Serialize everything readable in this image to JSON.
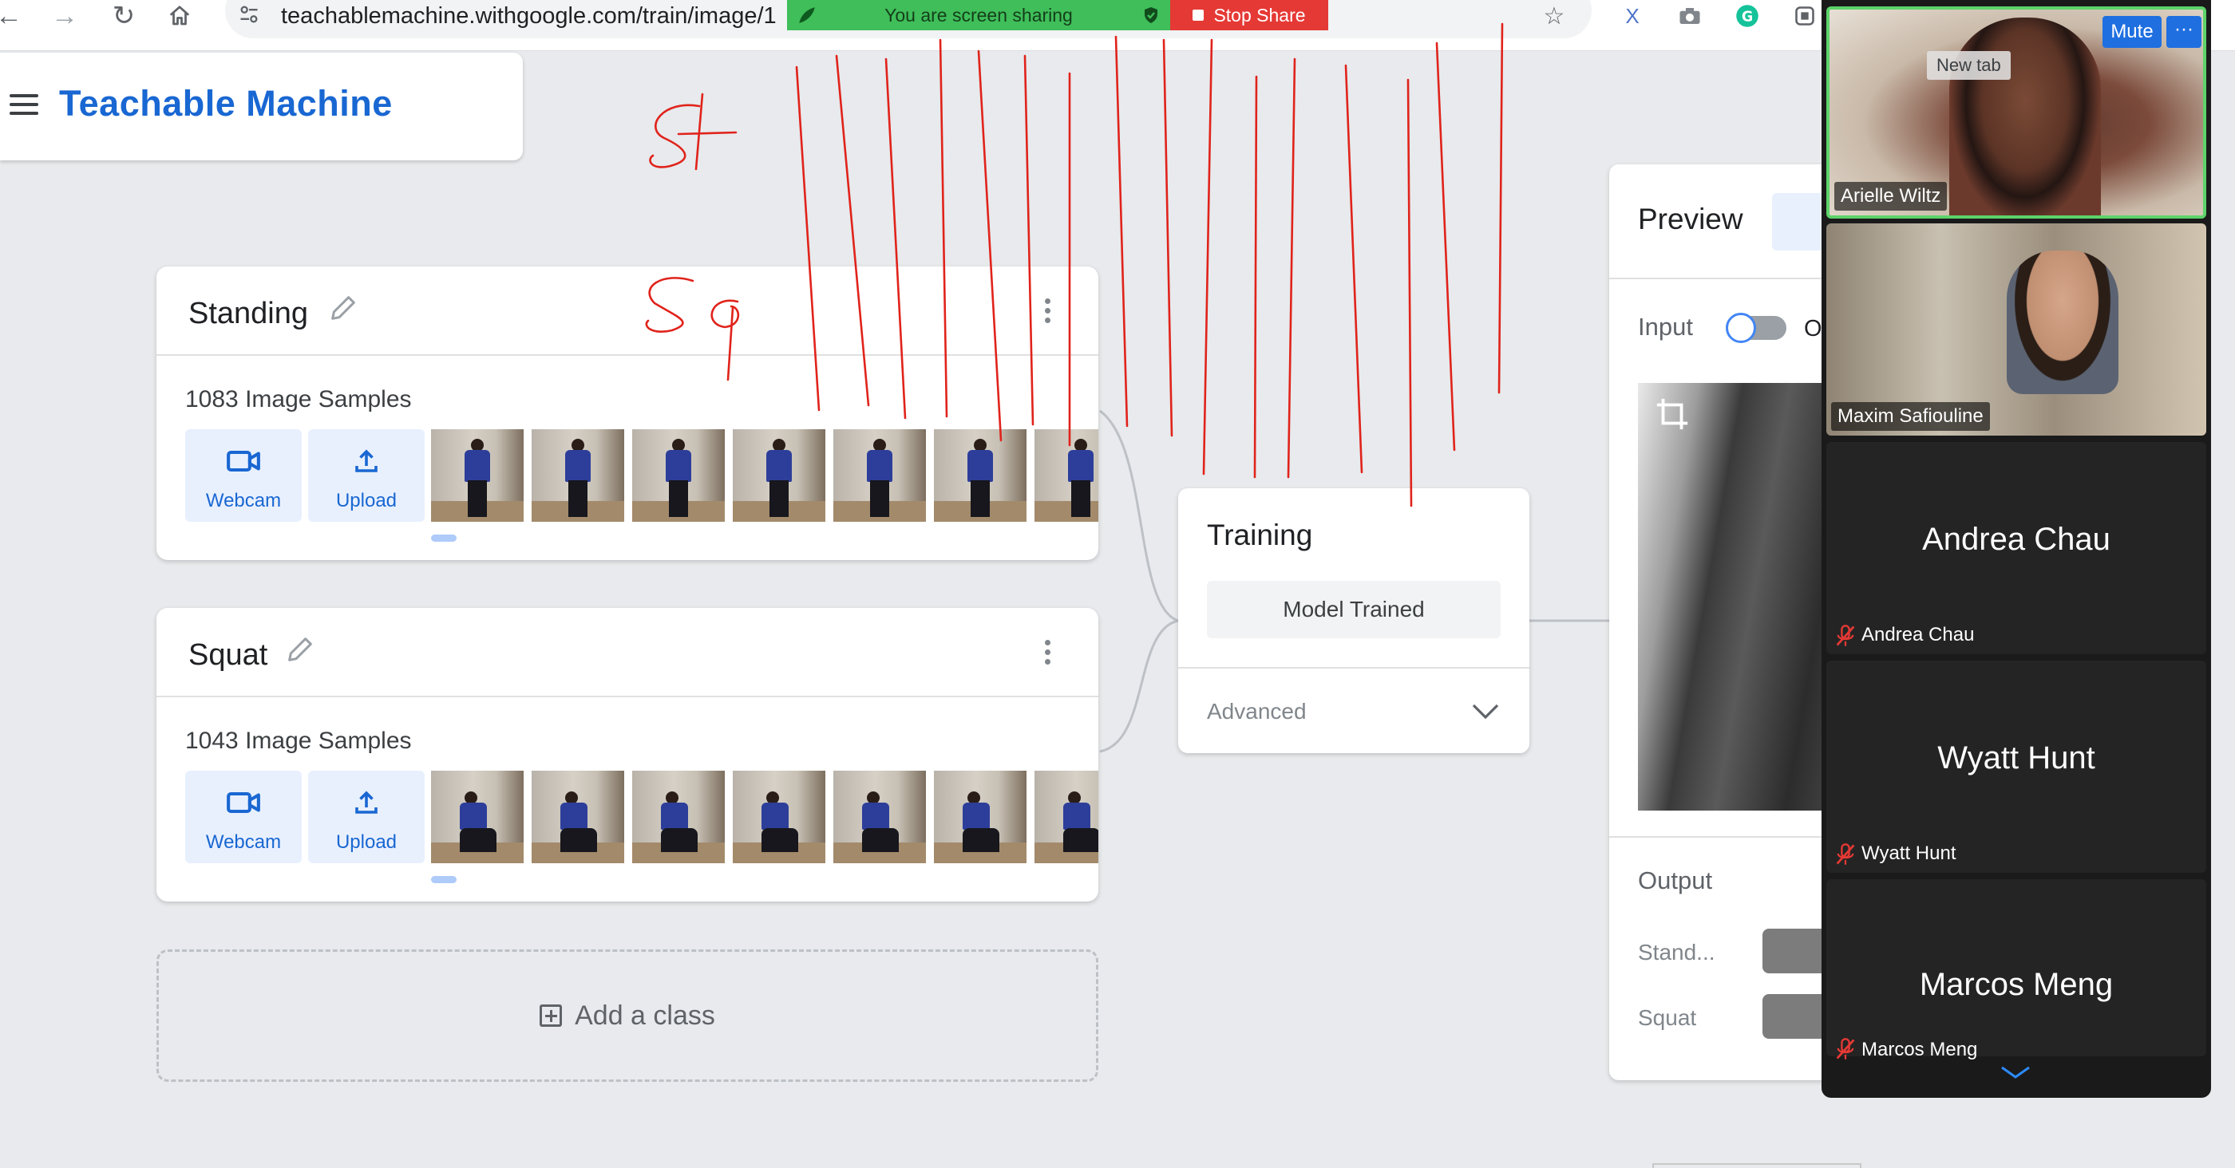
{
  "browser": {
    "url": "teachablemachine.withgoogle.com/train/image/1",
    "share_banner": "You are screen sharing",
    "stop_share": "Stop Share"
  },
  "app": {
    "title": "Teachable Machine"
  },
  "classes": [
    {
      "name": "Standing",
      "samples": "1083 Image Samples",
      "webcam_label": "Webcam",
      "upload_label": "Upload"
    },
    {
      "name": "Squat",
      "samples": "1043 Image Samples",
      "webcam_label": "Webcam",
      "upload_label": "Upload"
    }
  ],
  "add_class_label": "Add a class",
  "training": {
    "title": "Training",
    "button": "Model Trained",
    "advanced": "Advanced"
  },
  "preview": {
    "title": "Preview",
    "input_label": "Input",
    "input_toggle_text": "O",
    "output_label": "Output",
    "outputs": [
      {
        "label": "Stand..."
      },
      {
        "label": "Squat"
      }
    ]
  },
  "zoom": {
    "mute_label": "Mute",
    "more_label": "···",
    "tooltip": "New tab",
    "participants": [
      {
        "name": "Arielle Wiltz",
        "video": true
      },
      {
        "name": "Maxim Safiouline",
        "video": true
      },
      {
        "name": "Andrea Chau",
        "video": false
      },
      {
        "name": "Wyatt Hunt",
        "video": false
      },
      {
        "name": "Marcos Meng",
        "video": false
      }
    ]
  },
  "annotation_text": {
    "st": "St",
    "sq": "Sq"
  },
  "colors": {
    "brand_blue": "#1967d2",
    "annotation_red": "#e0231b",
    "share_green": "#3fbe5a",
    "stop_red": "#e53935"
  }
}
